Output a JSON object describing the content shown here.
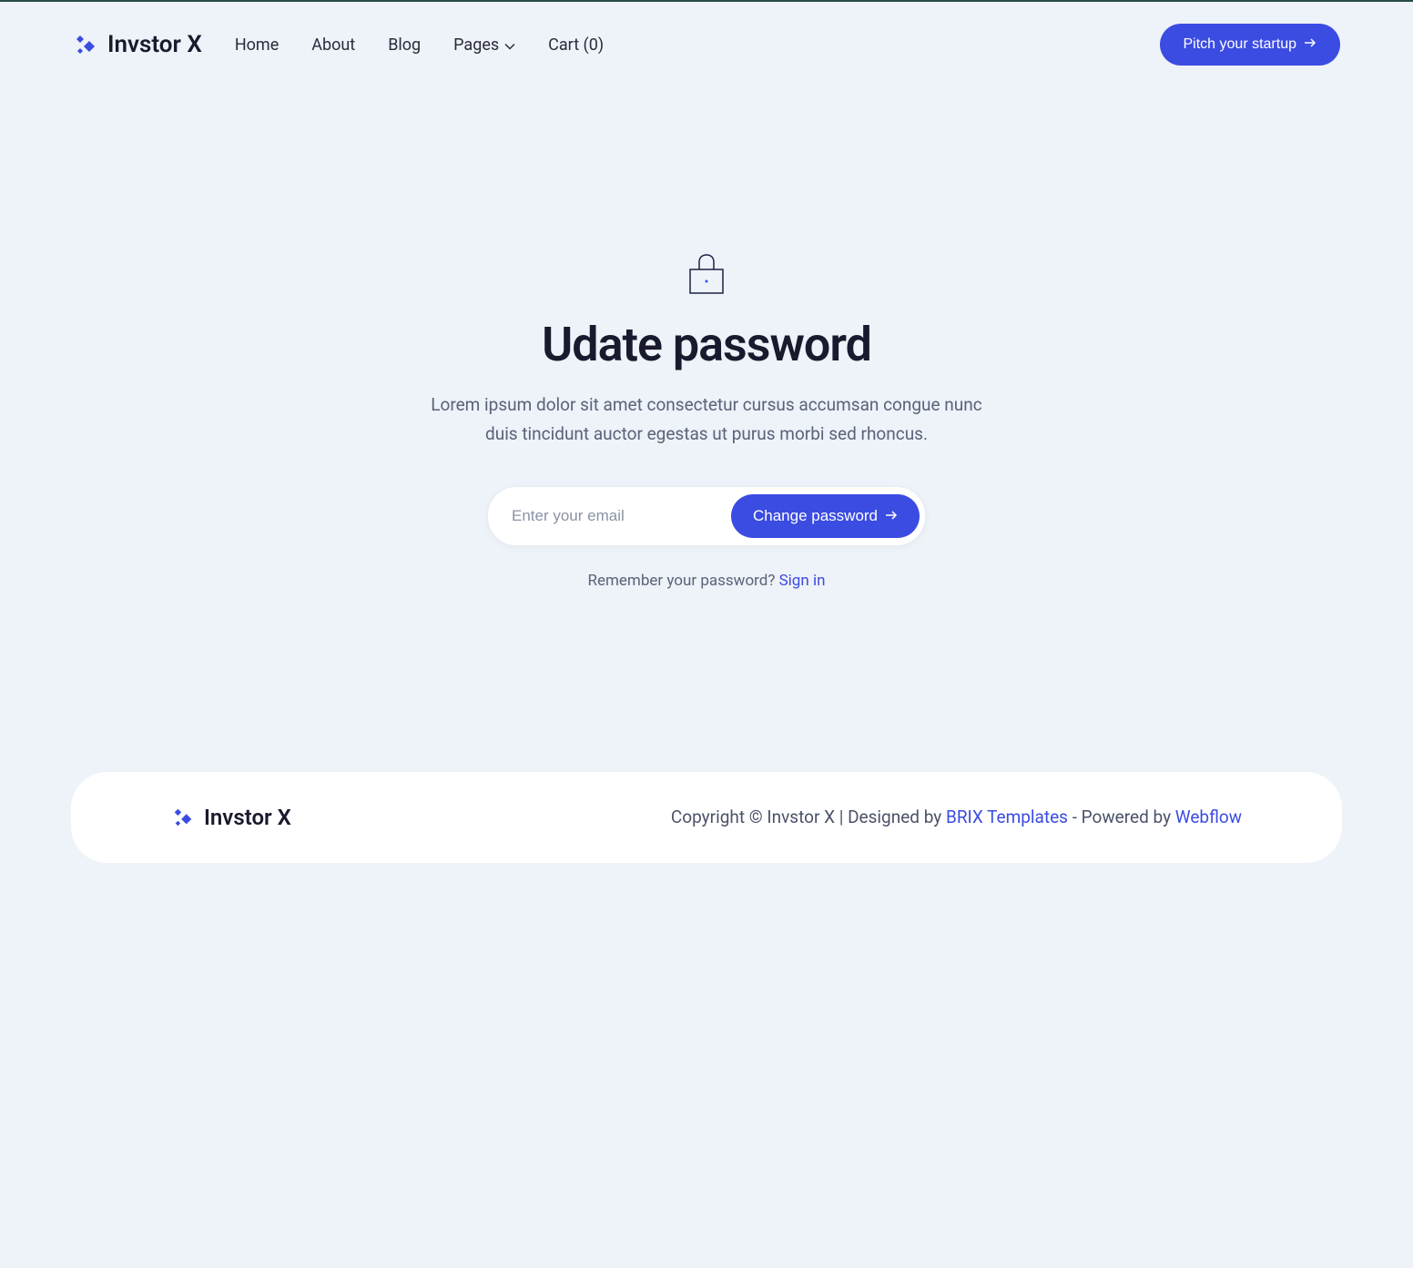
{
  "header": {
    "logo_text": "Invstor X",
    "nav": {
      "home": "Home",
      "about": "About",
      "blog": "Blog",
      "pages": "Pages",
      "cart": "Cart (0)"
    },
    "pitch_button": "Pitch your startup"
  },
  "main": {
    "title": "Udate password",
    "subtitle": "Lorem ipsum dolor sit amet consectetur cursus accumsan congue nunc duis tincidunt auctor egestas ut purus morbi sed rhoncus.",
    "email_placeholder": "Enter your email",
    "change_button": "Change password",
    "remember_text": "Remember your password? ",
    "signin_link": "Sign in"
  },
  "footer": {
    "logo_text": "Invstor X",
    "copyright_prefix": "Copyright © Invstor X | Designed by ",
    "brix_link": "BRIX Templates",
    "powered_text": " - Powered by ",
    "webflow_link": "Webflow"
  }
}
